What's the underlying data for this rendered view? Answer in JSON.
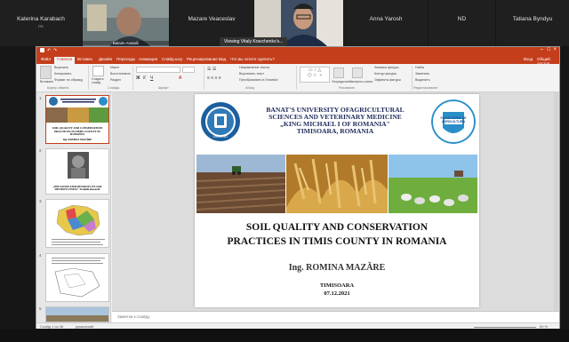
{
  "participants": [
    {
      "name": "Katerina Karabach",
      "subtitle": "Hs"
    },
    {
      "name": "Balaim Anatolii",
      "video": true
    },
    {
      "name": "Mazare Veaceslav"
    },
    {
      "name": "",
      "video": true
    },
    {
      "name": "Anna Yarosh"
    },
    {
      "name": "ND"
    },
    {
      "name": "Tatiana Byndyu"
    }
  ],
  "viewing_tooltip": "Viewing Vitaly Kravchenko's...",
  "ppt": {
    "menu_tabs": [
      "Файл",
      "Главная",
      "Вставка",
      "Дизайн",
      "Переходы",
      "Анимация",
      "Слайд-шоу",
      "Рецензирование",
      "Вид",
      "Что вы хотите сделать?"
    ],
    "active_tab": "Главная",
    "title_right": [
      "Вход",
      "Общий доступ"
    ],
    "ribbon": {
      "clipboard": "Буфер обмена",
      "slides": "Слайды",
      "font": "Шрифт",
      "paragraph": "Абзац",
      "drawing": "Рисование",
      "editing": "Редактирование",
      "create_slide": "Создать слайд",
      "paste": "Вставить",
      "cut": "Вырезать",
      "copy": "Копировать",
      "format_painter": "Формат по образцу",
      "layout": "Макет",
      "reset": "Восстановить",
      "section": "Раздел",
      "text_direction": "Направление текста",
      "align_text": "Выровнять текст",
      "smartart": "Преобразовать в SmartArt",
      "arrange": "Упорядочить",
      "quick_styles": "Экспресс-стили",
      "shape_fill": "Заливка фигуры",
      "shape_outline": "Контур фигуры",
      "shape_effects": "Эффекты фигуры",
      "find": "Найти",
      "replace": "Заменить",
      "select": "Выделить"
    },
    "slide_numbers": [
      "1",
      "2",
      "3",
      "4",
      "5"
    ],
    "notes_placeholder": "Заметки к слайду",
    "status_left": "Слайд 1 из 38",
    "status_lang": "румынский",
    "zoom": "60 %",
    "slide": {
      "university": [
        "BANAT'S UNIVERSITY OFAGRICULTURAL",
        "SCIENCES AND VETERINARY MEDICINE",
        "„KING MICHAEL I OF ROMANIA\"",
        "TIMISOARA, ROMANIA"
      ],
      "logo_right": "FACULTATEA DE AGRICULTURA",
      "logo_left": "USAMVBT",
      "title": [
        "SOIL QUALITY AND CONSERVATION",
        "PRACTICES IN TIMIS COUNTY IN ROMANIA"
      ],
      "author": "Ing. ROMINA MAZĂRE",
      "city": "TIMISOARA",
      "date": "07.12.2021"
    },
    "thumb_text": {
      "t1_title": "SOIL QUALITY AND CONSERVATION PRACTICES IN TIMIS COUNTY IN ROMANIA",
      "t1_author": "Ing. ROMINA MAZĂRE",
      "t2_caption": "„THE NATION THAT DESTROYS ITS SOIL DESTROYS ITSELF\" Franklin Roosevelt"
    }
  }
}
